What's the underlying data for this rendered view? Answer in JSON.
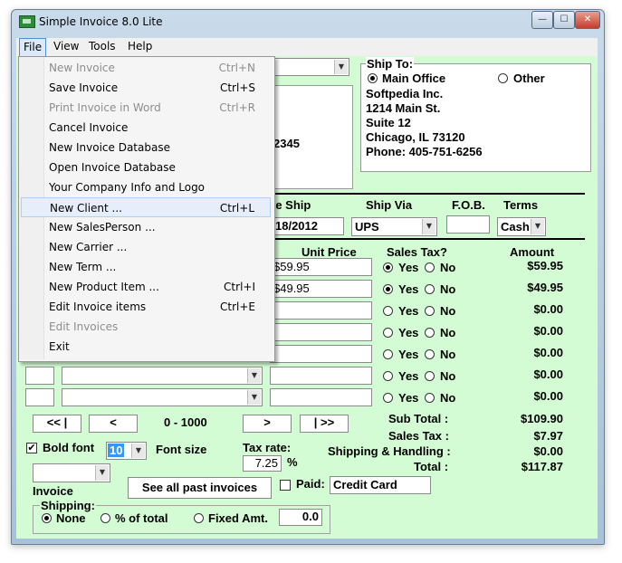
{
  "window": {
    "title": "Simple Invoice 8.0 Lite",
    "controls": {
      "minimize": "—",
      "maximize": "☐",
      "close": "✕"
    }
  },
  "menubar": [
    "File",
    "View",
    "Tools",
    "Help"
  ],
  "file_menu": [
    {
      "label": "New Invoice",
      "shortcut": "Ctrl+N",
      "enabled": false
    },
    {
      "label": "Save Invoice",
      "shortcut": "Ctrl+S",
      "enabled": true
    },
    {
      "label": "Print Invoice in Word",
      "shortcut": "Ctrl+R",
      "enabled": false
    },
    {
      "label": "Cancel Invoice",
      "shortcut": "",
      "enabled": true
    },
    {
      "label": "New Invoice Database",
      "shortcut": "",
      "enabled": true
    },
    {
      "label": "Open Invoice Database",
      "shortcut": "",
      "enabled": true
    },
    {
      "label": "Your Company Info and Logo",
      "shortcut": "",
      "enabled": true
    },
    {
      "label": "New Client ...",
      "shortcut": "Ctrl+L",
      "enabled": true,
      "highlighted": true
    },
    {
      "label": "New SalesPerson ...",
      "shortcut": "",
      "enabled": true
    },
    {
      "label": "New Carrier ...",
      "shortcut": "",
      "enabled": true
    },
    {
      "label": "New Term ...",
      "shortcut": "",
      "enabled": true
    },
    {
      "label": "New Product Item ...",
      "shortcut": "Ctrl+I",
      "enabled": true
    },
    {
      "label": "Edit Invoice items",
      "shortcut": "Ctrl+E",
      "enabled": true
    },
    {
      "label": "Edit Invoices",
      "shortcut": "",
      "enabled": false
    },
    {
      "label": "Exit",
      "shortcut": "",
      "enabled": true
    }
  ],
  "bill_to": {
    "partial_line": "2345"
  },
  "ship_to": {
    "title": "Ship To:",
    "options": [
      "Main Office",
      "Other"
    ],
    "selected": "Main Office",
    "lines": [
      "Softpedia Inc.",
      "1214 Main St.",
      "Suite 12",
      "Chicago, IL 73120",
      "Phone: 405-751-6256"
    ]
  },
  "shipping_header": {
    "date_ship_label": "te Ship",
    "ship_via_label": "Ship Via",
    "fob_label": "F.O.B.",
    "terms_label": "Terms",
    "date_ship_value": "18/2012",
    "ship_via_value": "UPS",
    "fob_value": "",
    "terms_value": "Cash"
  },
  "items_header": {
    "unit_price": "Unit Price",
    "sales_tax": "Sales Tax?",
    "amount": "Amount"
  },
  "yes_label": "Yes",
  "no_label": "No",
  "items": [
    {
      "unit_price": "$59.95",
      "tax": "Yes",
      "amount": "$59.95"
    },
    {
      "unit_price": "$49.95",
      "tax": "Yes",
      "amount": "$49.95"
    },
    {
      "unit_price": "",
      "tax": "",
      "amount": "$0.00"
    },
    {
      "unit_price": "",
      "tax": "",
      "amount": "$0.00"
    },
    {
      "unit_price": "",
      "tax": "",
      "amount": "$0.00"
    },
    {
      "unit_price": "",
      "tax": "",
      "amount": "$0.00"
    },
    {
      "unit_price": "",
      "tax": "",
      "amount": "$0.00"
    }
  ],
  "pager": {
    "first": "<< |",
    "prev": "<",
    "range": "0 - 1000",
    "next": ">",
    "last": "| >>"
  },
  "totals": {
    "sub_total_label": "Sub Total :",
    "sub_total": "$109.90",
    "sales_tax_label": "Sales Tax :",
    "sales_tax": "$7.97",
    "shipping_label": "Shipping & Handling :",
    "shipping": "$0.00",
    "total_label": "Total :",
    "total": "$117.87"
  },
  "options": {
    "bold_font_label": "Bold font",
    "bold_font_checked": true,
    "font_size_label": "Font size",
    "font_size_value": "10",
    "tax_rate_label": "Tax rate:",
    "tax_rate_value": "7.25",
    "tax_rate_unit": "%",
    "invoice_label": "Invoice",
    "see_all_button": "See all past invoices",
    "paid_label": "Paid:",
    "paid_checked": false,
    "paid_value": "Credit Card"
  },
  "shipping_box": {
    "title": "Shipping:",
    "options": [
      "None",
      "% of total",
      "Fixed Amt."
    ],
    "selected": "None",
    "amount": "0.0"
  },
  "colors": {
    "form_bg": "#d4fcd4",
    "menu_highlight": "#e6eefb",
    "title_bar": "#b9cfe4"
  }
}
